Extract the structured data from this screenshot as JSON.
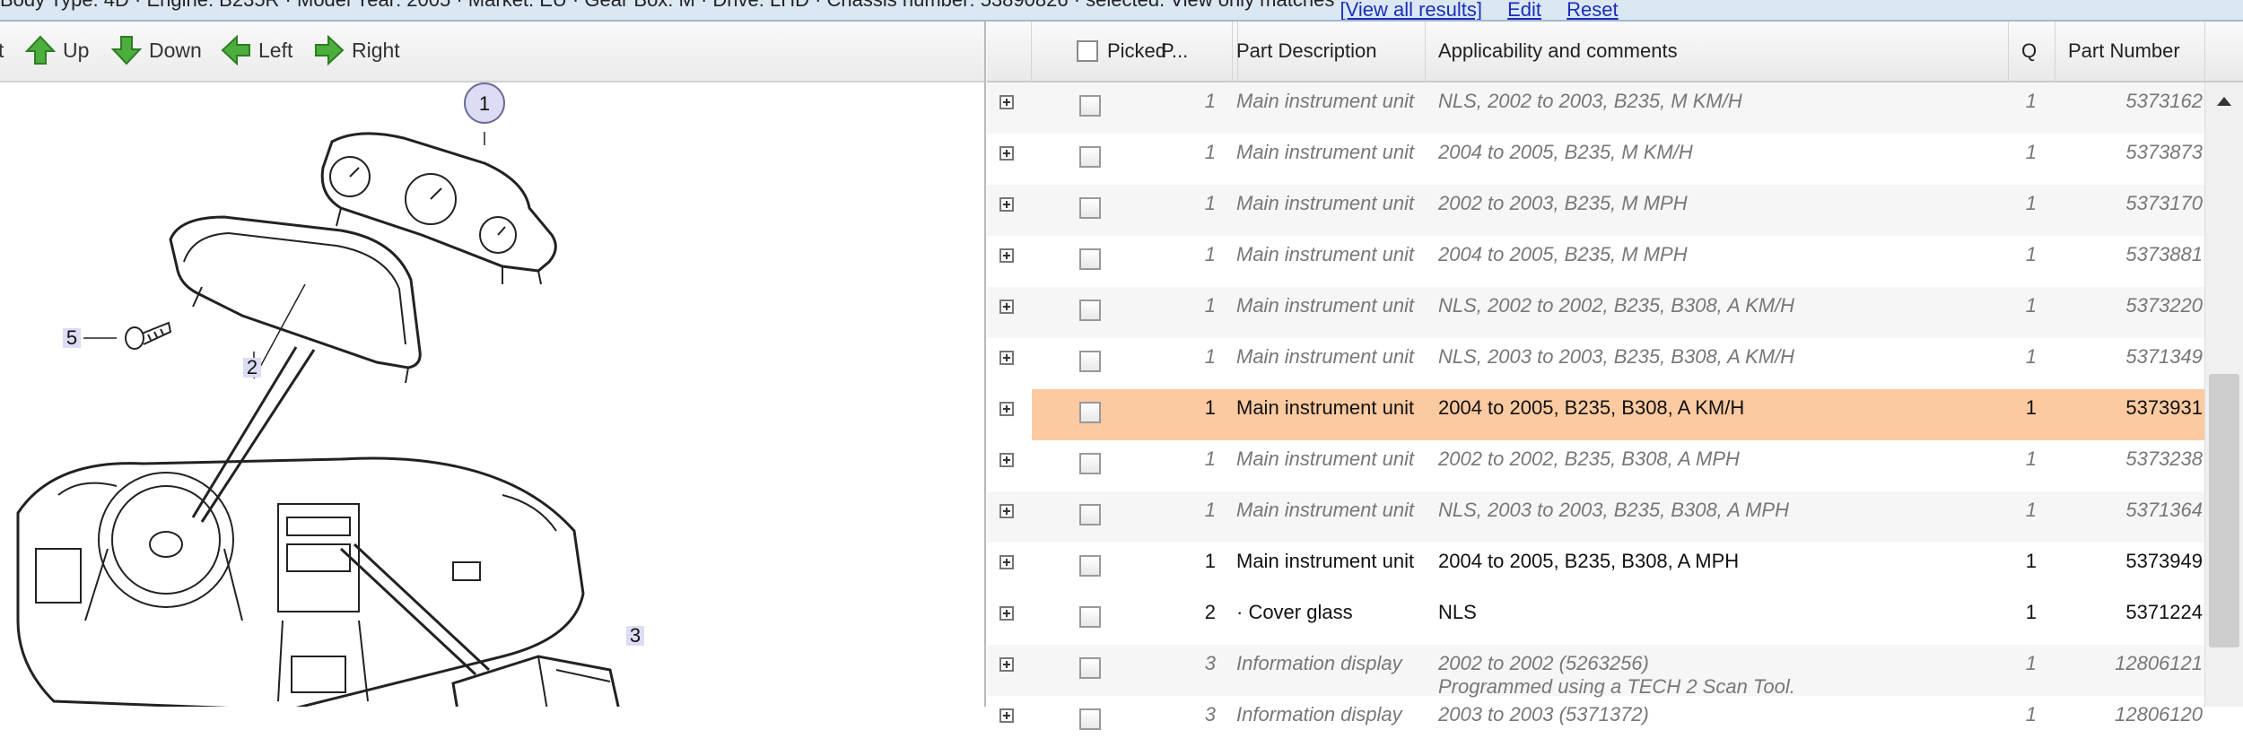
{
  "topbar": {
    "text": "Body Type: 4D · Engine: B235R · Model Year: 2005 · Market: EU · Gear Box: M · Drive: LHD · Chassis number: 53890826 · selected. View only matches",
    "view_all": "[View all results]",
    "edit": "Edit",
    "reset": "Reset"
  },
  "toolbar": {
    "print_label": "t",
    "up": "Up",
    "down": "Down",
    "left": "Left",
    "right": "Right"
  },
  "diagram": {
    "callouts": [
      "1",
      "2",
      "3",
      "5"
    ]
  },
  "grid": {
    "headers": {
      "picked": "Picked",
      "pos": "P...",
      "desc": "Part Description",
      "app": "Applicability and comments",
      "qty": "Q",
      "part": "Part Number"
    },
    "rows": [
      {
        "pos": "1",
        "desc": "Main instrument unit",
        "app": "NLS, 2002 to 2003, B235, M KM/H",
        "note": "",
        "qty": "1",
        "part": "5373162"
      },
      {
        "pos": "1",
        "desc": "Main instrument unit",
        "app": "2004 to 2005, B235, M KM/H",
        "note": "",
        "qty": "1",
        "part": "5373873"
      },
      {
        "pos": "1",
        "desc": "Main instrument unit",
        "app": "2002 to 2003, B235, M MPH",
        "note": "",
        "qty": "1",
        "part": "5373170"
      },
      {
        "pos": "1",
        "desc": "Main instrument unit",
        "app": "2004 to 2005, B235, M MPH",
        "note": "",
        "qty": "1",
        "part": "5373881"
      },
      {
        "pos": "1",
        "desc": "Main instrument unit",
        "app": "NLS, 2002 to 2002, B235, B308, A KM/H",
        "note": "",
        "qty": "1",
        "part": "5373220"
      },
      {
        "pos": "1",
        "desc": "Main instrument unit",
        "app": "NLS, 2003 to 2003, B235, B308, A KM/H",
        "note": "",
        "qty": "1",
        "part": "5371349"
      },
      {
        "pos": "1",
        "desc": "Main instrument unit",
        "app": "2004 to 2005, B235, B308, A KM/H",
        "note": "",
        "qty": "1",
        "part": "5373931"
      },
      {
        "pos": "1",
        "desc": "Main instrument unit",
        "app": "2002 to 2002, B235, B308, A MPH",
        "note": "",
        "qty": "1",
        "part": "5373238"
      },
      {
        "pos": "1",
        "desc": "Main instrument unit",
        "app": "NLS, 2003 to 2003, B235, B308, A MPH",
        "note": "",
        "qty": "1",
        "part": "5371364"
      },
      {
        "pos": "1",
        "desc": "Main instrument unit",
        "app": "2004 to 2005, B235, B308, A MPH",
        "note": "",
        "qty": "1",
        "part": "5373949"
      },
      {
        "pos": "2",
        "desc": "· Cover glass",
        "app": "NLS",
        "note": "",
        "qty": "1",
        "part": "5371224"
      },
      {
        "pos": "3",
        "desc": "Information display",
        "app": "2002 to 2002 (5263256)",
        "note": "Programmed using a TECH 2 Scan Tool.",
        "qty": "1",
        "part": "12806121"
      },
      {
        "pos": "3",
        "desc": "Information display",
        "app": "2003 to 2003 (5371372)",
        "note": "",
        "qty": "1",
        "part": "12806120"
      }
    ]
  },
  "colors": {
    "selected_row": "#fccaa1",
    "link": "#1a2db8",
    "callout_fill": "#dcdcf4"
  }
}
